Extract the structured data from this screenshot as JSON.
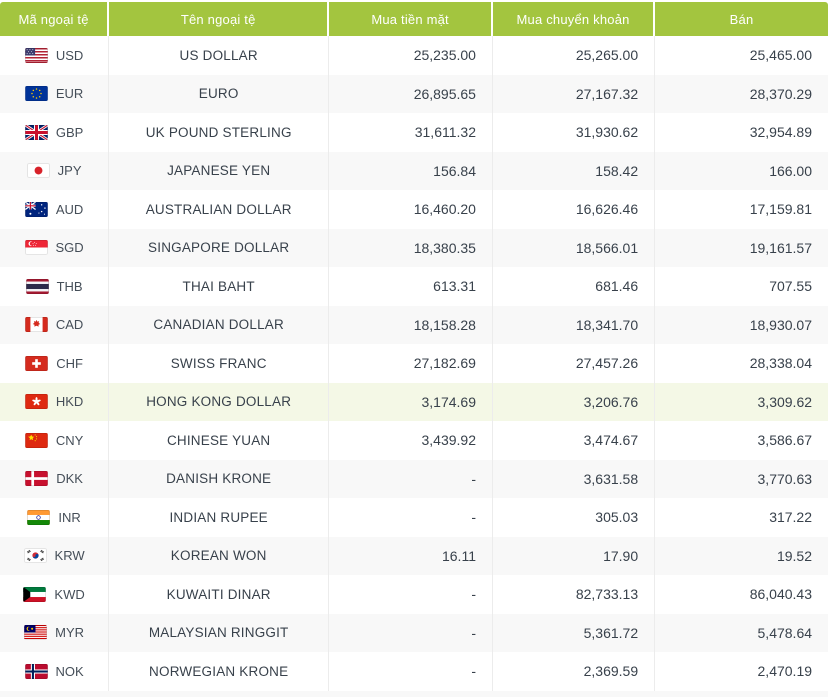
{
  "colors": {
    "header_bg": "#a3c53f",
    "header_text": "#ffffff",
    "row_alt_bg": "#f8f8f8",
    "row_highlight_bg": "#f4f8e6",
    "text": "#38414b",
    "divider": "#ececec"
  },
  "table": {
    "columns": [
      {
        "key": "code",
        "label": "Mã ngoại tệ"
      },
      {
        "key": "name",
        "label": "Tên ngoại tệ"
      },
      {
        "key": "cash",
        "label": "Mua tiền mặt"
      },
      {
        "key": "transfer",
        "label": "Mua chuyển khoản"
      },
      {
        "key": "sell",
        "label": "Bán"
      }
    ],
    "rows": [
      {
        "code": "USD",
        "name": "US DOLLAR",
        "flag": "flag-usd",
        "cash": "25,235.00",
        "transfer": "25,265.00",
        "sell": "25,465.00",
        "highlighted": false
      },
      {
        "code": "EUR",
        "name": "EURO",
        "flag": "flag-eur",
        "cash": "26,895.65",
        "transfer": "27,167.32",
        "sell": "28,370.29",
        "highlighted": false
      },
      {
        "code": "GBP",
        "name": "UK POUND STERLING",
        "flag": "flag-gbp",
        "cash": "31,611.32",
        "transfer": "31,930.62",
        "sell": "32,954.89",
        "highlighted": false
      },
      {
        "code": "JPY",
        "name": "JAPANESE YEN",
        "flag": "flag-jpy",
        "cash": "156.84",
        "transfer": "158.42",
        "sell": "166.00",
        "highlighted": false
      },
      {
        "code": "AUD",
        "name": "AUSTRALIAN DOLLAR",
        "flag": "flag-aud",
        "cash": "16,460.20",
        "transfer": "16,626.46",
        "sell": "17,159.81",
        "highlighted": false
      },
      {
        "code": "SGD",
        "name": "SINGAPORE DOLLAR",
        "flag": "flag-sgd",
        "cash": "18,380.35",
        "transfer": "18,566.01",
        "sell": "19,161.57",
        "highlighted": false
      },
      {
        "code": "THB",
        "name": "THAI BAHT",
        "flag": "flag-thb",
        "cash": "613.31",
        "transfer": "681.46",
        "sell": "707.55",
        "highlighted": false
      },
      {
        "code": "CAD",
        "name": "CANADIAN DOLLAR",
        "flag": "flag-cad",
        "cash": "18,158.28",
        "transfer": "18,341.70",
        "sell": "18,930.07",
        "highlighted": false
      },
      {
        "code": "CHF",
        "name": "SWISS FRANC",
        "flag": "flag-chf",
        "cash": "27,182.69",
        "transfer": "27,457.26",
        "sell": "28,338.04",
        "highlighted": false
      },
      {
        "code": "HKD",
        "name": "HONG KONG DOLLAR",
        "flag": "flag-hkd",
        "cash": "3,174.69",
        "transfer": "3,206.76",
        "sell": "3,309.62",
        "highlighted": true
      },
      {
        "code": "CNY",
        "name": "CHINESE YUAN",
        "flag": "flag-cny",
        "cash": "3,439.92",
        "transfer": "3,474.67",
        "sell": "3,586.67",
        "highlighted": false
      },
      {
        "code": "DKK",
        "name": "DANISH KRONE",
        "flag": "flag-dkk",
        "cash": "-",
        "transfer": "3,631.58",
        "sell": "3,770.63",
        "highlighted": false
      },
      {
        "code": "INR",
        "name": "INDIAN RUPEE",
        "flag": "flag-inr",
        "cash": "-",
        "transfer": "305.03",
        "sell": "317.22",
        "highlighted": false
      },
      {
        "code": "KRW",
        "name": "KOREAN WON",
        "flag": "flag-krw",
        "cash": "16.11",
        "transfer": "17.90",
        "sell": "19.52",
        "highlighted": false
      },
      {
        "code": "KWD",
        "name": "KUWAITI DINAR",
        "flag": "flag-kwd",
        "cash": "-",
        "transfer": "82,733.13",
        "sell": "86,040.43",
        "highlighted": false
      },
      {
        "code": "MYR",
        "name": "MALAYSIAN RINGGIT",
        "flag": "flag-myr",
        "cash": "-",
        "transfer": "5,361.72",
        "sell": "5,478.64",
        "highlighted": false
      },
      {
        "code": "NOK",
        "name": "NORWEGIAN KRONE",
        "flag": "flag-nok",
        "cash": "-",
        "transfer": "2,369.59",
        "sell": "2,470.19",
        "highlighted": false
      }
    ]
  }
}
